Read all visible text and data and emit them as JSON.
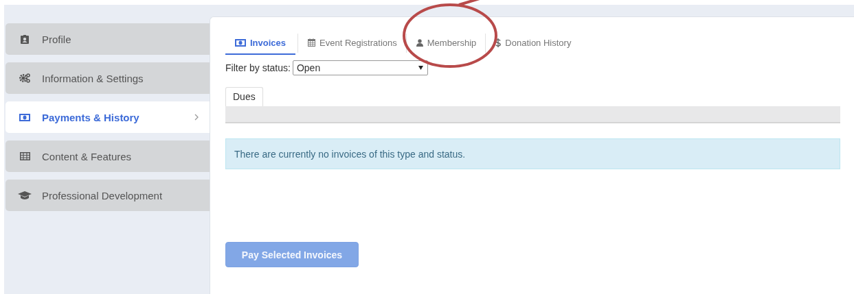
{
  "sidebar": {
    "items": [
      {
        "label": "Profile",
        "kind": "profile",
        "selected": false
      },
      {
        "label": "Information & Settings",
        "kind": "gears",
        "selected": false
      },
      {
        "label": "Payments & History",
        "kind": "money",
        "selected": true
      },
      {
        "label": "Content & Features",
        "kind": "grid",
        "selected": false
      },
      {
        "label": "Professional Development",
        "kind": "cap",
        "selected": false
      }
    ]
  },
  "tabs": [
    {
      "label": "Invoices",
      "kind": "money",
      "selected": true
    },
    {
      "label": "Event Registrations",
      "kind": "calendar",
      "selected": false
    },
    {
      "label": "Membership",
      "kind": "user",
      "selected": false
    },
    {
      "label": "Donation History",
      "kind": "dollar",
      "selected": false
    }
  ],
  "filter": {
    "label": "Filter by status:",
    "value": "Open"
  },
  "subtabs": [
    {
      "label": "Dues",
      "selected": true
    }
  ],
  "message": "There are currently no invoices of this type and status.",
  "pay_button": {
    "label": "Pay Selected Invoices",
    "disabled": true
  }
}
